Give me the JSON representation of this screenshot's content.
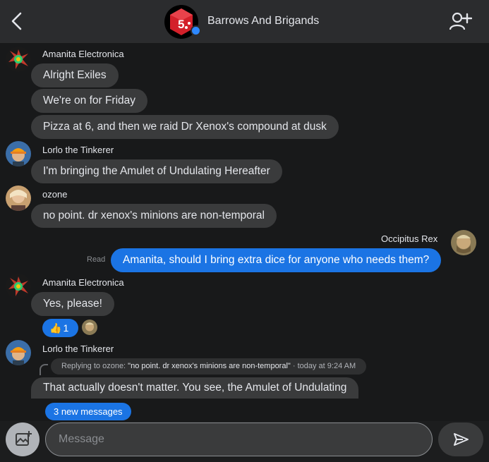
{
  "header": {
    "title": "Barrows And Brigands",
    "group_avatar_text": "5",
    "back_icon": "chevron-left-icon",
    "add_user_icon": "add-user-icon"
  },
  "messages": {
    "m1": {
      "sender": "Amanita Electronica",
      "lines": [
        "Alright Exiles",
        "We're on for Friday",
        "Pizza at 6, and then we raid Dr Xenox's compound at dusk"
      ]
    },
    "m2": {
      "sender": "Lorlo the Tinkerer",
      "text": "I'm bringing the Amulet of Undulating Hereafter"
    },
    "m3": {
      "sender": "ozone",
      "text": "no point. dr xenox's minions are non-temporal"
    },
    "m4": {
      "sender": "Occipitus Rex",
      "text": "Amanita, should I bring extra dice for anyone who needs them?",
      "status": "Read"
    },
    "m5": {
      "sender": "Amanita Electronica",
      "text": "Yes, please!",
      "reaction_emoji": "👍",
      "reaction_count": "1"
    },
    "m6": {
      "sender": "Lorlo the Tinkerer",
      "reply_prefix": "Replying to ozone: ",
      "reply_quote": "\"no point. dr xenox's minions are non-temporal\"",
      "reply_time": " · today at 9:24 AM",
      "text": "That actually doesn't matter. You see, the Amulet of Undulating"
    }
  },
  "new_messages_label": "3 new messages",
  "composer": {
    "placeholder": "Message",
    "photo_icon": "add-photo-icon",
    "send_icon": "send-icon"
  },
  "colors": {
    "accent": "#1b74e4",
    "bubble_in": "#3a3b3c",
    "header": "#2b2c2e",
    "background": "#18191a"
  }
}
